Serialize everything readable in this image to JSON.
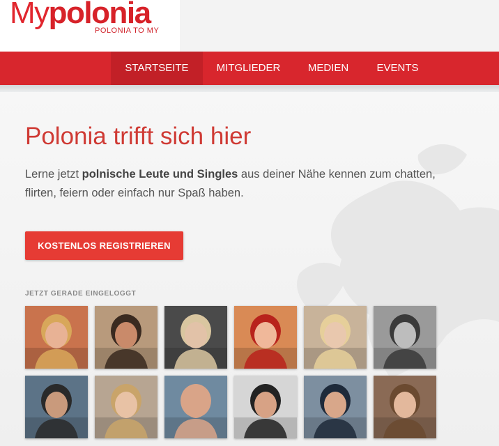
{
  "brand": {
    "logo_prefix": "My",
    "logo_name": "polonia",
    "tagline": "POLONIA TO MY"
  },
  "nav": {
    "items": [
      {
        "label": "STARTSEITE",
        "active": true
      },
      {
        "label": "MITGLIEDER",
        "active": false
      },
      {
        "label": "MEDIEN",
        "active": false
      },
      {
        "label": "EVENTS",
        "active": false
      }
    ]
  },
  "hero": {
    "title": "Polonia trifft sich hier",
    "intro_before": "Lerne jetzt ",
    "intro_bold": "polnische Leute und Singles",
    "intro_after": " aus deiner Nähe kennen zum chatten, flirten, feiern oder einfach nur Spaß haben.",
    "register_button": "KOSTENLOS REGISTRIEREN"
  },
  "online": {
    "label": "JETZT GERADE EINGELOGGT",
    "members": [
      {
        "bg": "#c9734d",
        "skin": "#e8b295",
        "hair": "#d8a75a"
      },
      {
        "bg": "#b89a7c",
        "skin": "#c98a6a",
        "hair": "#3a2a20"
      },
      {
        "bg": "#4a4a4a",
        "skin": "#e2c2a8",
        "hair": "#d9c6a0"
      },
      {
        "bg": "#d98a55",
        "skin": "#f0b89a",
        "hair": "#b8231c"
      },
      {
        "bg": "#c8b39a",
        "skin": "#e9c8ae",
        "hair": "#e6cf9a"
      },
      {
        "bg": "#9a9a9a",
        "skin": "#bdbdbd",
        "hair": "#3a3a3a"
      },
      {
        "bg": "#5c7387",
        "skin": "#c99a7c",
        "hair": "#2a2a2a"
      },
      {
        "bg": "#b7a592",
        "skin": "#e8c2a5",
        "hair": "#c9a46a"
      },
      {
        "bg": "#6f8aa0",
        "skin": "#d9a488",
        "hair": "#d9a488"
      },
      {
        "bg": "#d6d6d6",
        "skin": "#d7a285",
        "hair": "#222222"
      },
      {
        "bg": "#7d8fa0",
        "skin": "#d8a78a",
        "hair": "#1e2a3a"
      },
      {
        "bg": "#8a6a55",
        "skin": "#e3b89c",
        "hair": "#6b4a30"
      }
    ]
  }
}
